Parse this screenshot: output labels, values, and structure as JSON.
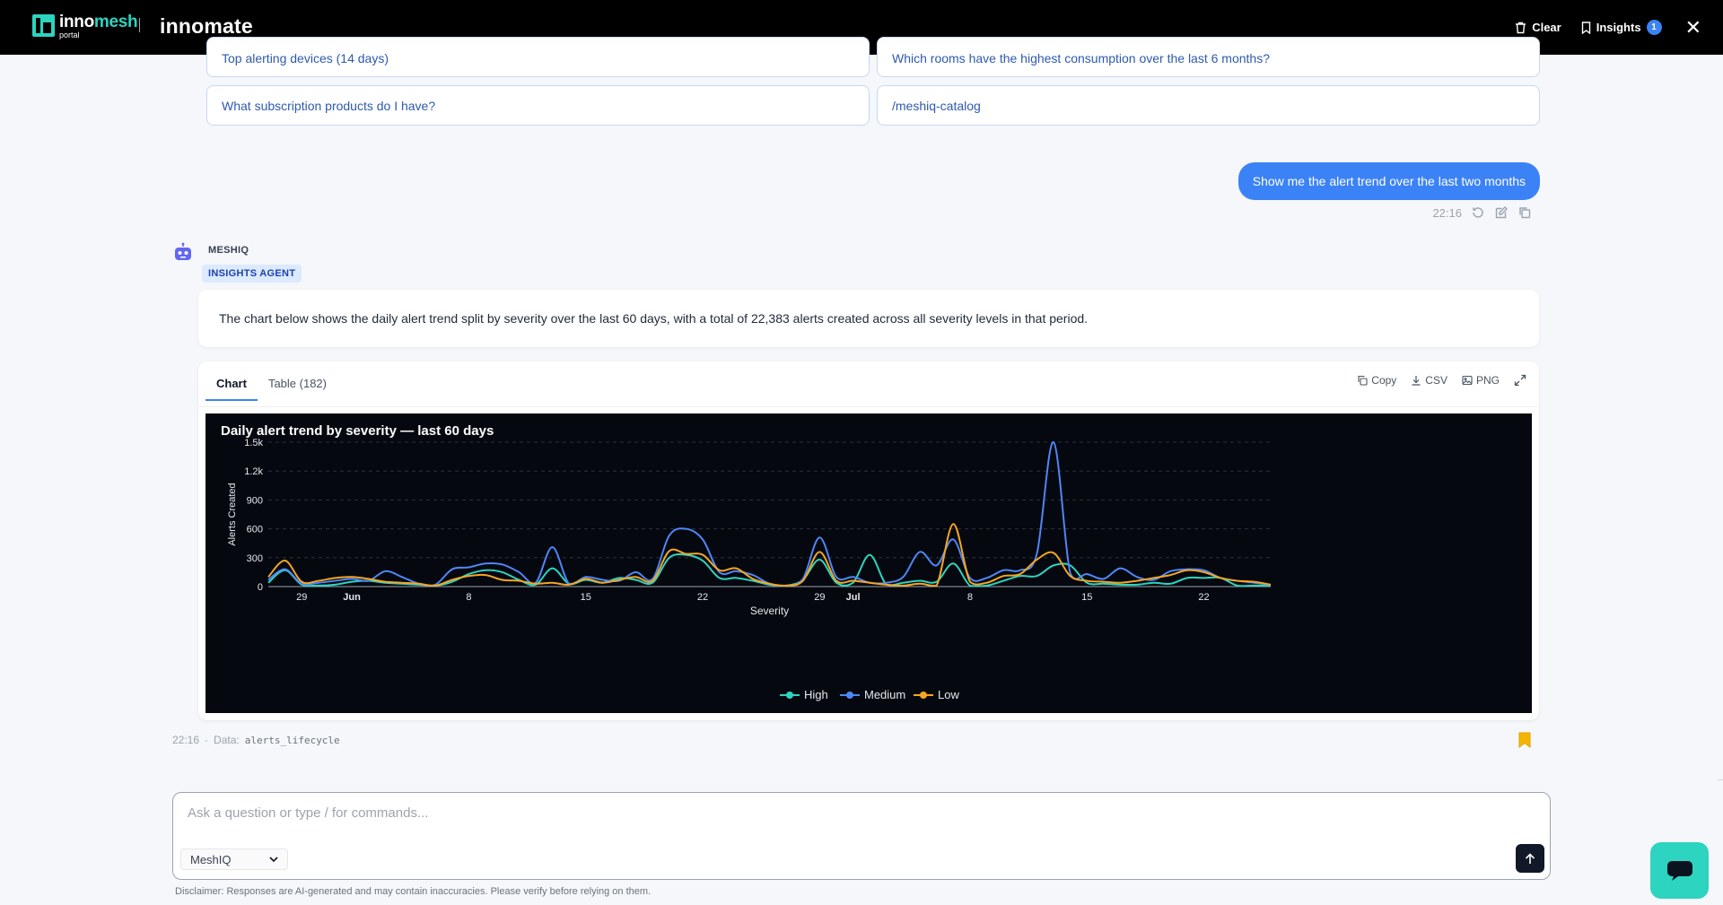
{
  "header": {
    "logo_part1": "inno",
    "logo_part2": "mesh",
    "logo_sub": "portal",
    "brand": "innomate",
    "clear_label": "Clear",
    "insights_label": "Insights",
    "insights_count": "1"
  },
  "suggestions": [
    "Top alerting devices (14 days)",
    "Which rooms have the highest consumption over the last 6 months?",
    "What subscription products do I have?",
    "/meshiq-catalog"
  ],
  "user_message": {
    "text": "Show me the alert trend over the last two months",
    "time": "22:16"
  },
  "agent": {
    "name": "MESHIQ",
    "tag": "INSIGHTS AGENT",
    "message": "The chart below shows the daily alert trend split by severity over the last 60 days, with a total of 22,383 alerts created across all severity levels in that period."
  },
  "chart_card": {
    "tabs": [
      "Chart",
      "Table (182)"
    ],
    "tools": {
      "copy": "Copy",
      "csv": "CSV",
      "png": "PNG"
    },
    "meta_time": "22:16",
    "meta_label": "Data:",
    "meta_source": "alerts_lifecycle"
  },
  "composer": {
    "placeholder": "Ask a question or type / for commands...",
    "agent_option": "MeshIQ",
    "disclaimer": "Disclaimer: Responses are AI-generated and may contain inaccuracies. Please verify before relying on them."
  },
  "colors": {
    "high": "#2dd4bf",
    "medium": "#4f86f7",
    "low": "#f5a623",
    "accent": "#3b82f6"
  },
  "chart_data": {
    "type": "line",
    "title": "Daily alert trend by severity — last 60 days",
    "xlabel": "Severity",
    "ylabel": "Alerts Created",
    "x_tick_labels": [
      "29",
      "Jun",
      "8",
      "15",
      "22",
      "29",
      "Jul",
      "8",
      "15",
      "22"
    ],
    "x_tick_index": [
      2,
      5,
      12,
      19,
      26,
      33,
      35,
      42,
      49,
      56
    ],
    "x": [
      "May 27",
      "May 28",
      "May 29",
      "May 30",
      "May 31",
      "Jun 1",
      "Jun 2",
      "Jun 3",
      "Jun 4",
      "Jun 5",
      "Jun 6",
      "Jun 7",
      "Jun 8",
      "Jun 9",
      "Jun 10",
      "Jun 11",
      "Jun 12",
      "Jun 13",
      "Jun 14",
      "Jun 15",
      "Jun 16",
      "Jun 17",
      "Jun 18",
      "Jun 19",
      "Jun 20",
      "Jun 21",
      "Jun 22",
      "Jun 23",
      "Jun 24",
      "Jun 25",
      "Jun 26",
      "Jun 27",
      "Jun 28",
      "Jun 29",
      "Jun 30",
      "Jul 1",
      "Jul 2",
      "Jul 3",
      "Jul 4",
      "Jul 5",
      "Jul 6",
      "Jul 7",
      "Jul 8",
      "Jul 9",
      "Jul 10",
      "Jul 11",
      "Jul 12",
      "Jul 13",
      "Jul 14",
      "Jul 15",
      "Jul 16",
      "Jul 17",
      "Jul 18",
      "Jul 19",
      "Jul 20",
      "Jul 21",
      "Jul 22",
      "Jul 23",
      "Jul 24",
      "Jul 25",
      "Jul 26"
    ],
    "ylim": [
      0,
      1500
    ],
    "y_ticks": [
      0,
      300,
      600,
      900,
      1200,
      1500
    ],
    "y_tick_labels": [
      "0",
      "300",
      "600",
      "900",
      "1.2k",
      "1.5k"
    ],
    "grid": true,
    "legend": "bottom-center",
    "series": [
      {
        "name": "High",
        "values": [
          40,
          170,
          20,
          10,
          20,
          50,
          60,
          40,
          30,
          20,
          10,
          50,
          130,
          170,
          150,
          70,
          20,
          190,
          30,
          70,
          40,
          90,
          70,
          40,
          300,
          330,
          270,
          90,
          90,
          60,
          20,
          10,
          70,
          280,
          40,
          40,
          330,
          20,
          40,
          60,
          50,
          240,
          10,
          10,
          60,
          110,
          110,
          220,
          220,
          40,
          30,
          20,
          20,
          40,
          30,
          90,
          90,
          90,
          10,
          10,
          10
        ]
      },
      {
        "name": "Medium",
        "values": [
          70,
          180,
          30,
          40,
          60,
          80,
          60,
          160,
          100,
          30,
          20,
          180,
          200,
          240,
          230,
          150,
          40,
          410,
          30,
          100,
          70,
          60,
          150,
          80,
          530,
          600,
          490,
          150,
          160,
          120,
          30,
          10,
          80,
          510,
          100,
          100,
          40,
          40,
          100,
          360,
          220,
          490,
          90,
          90,
          170,
          170,
          340,
          1500,
          140,
          130,
          80,
          190,
          100,
          70,
          160,
          180,
          170,
          90,
          60,
          40,
          20
        ]
      },
      {
        "name": "Low",
        "values": [
          100,
          270,
          50,
          60,
          90,
          100,
          80,
          50,
          40,
          30,
          10,
          70,
          110,
          120,
          70,
          60,
          30,
          40,
          20,
          80,
          40,
          70,
          100,
          60,
          370,
          340,
          330,
          170,
          190,
          80,
          30,
          10,
          60,
          360,
          60,
          60,
          40,
          20,
          10,
          30,
          10,
          650,
          50,
          40,
          110,
          130,
          280,
          350,
          110,
          60,
          50,
          40,
          60,
          90,
          120,
          170,
          150,
          90,
          60,
          50,
          20
        ]
      }
    ]
  }
}
